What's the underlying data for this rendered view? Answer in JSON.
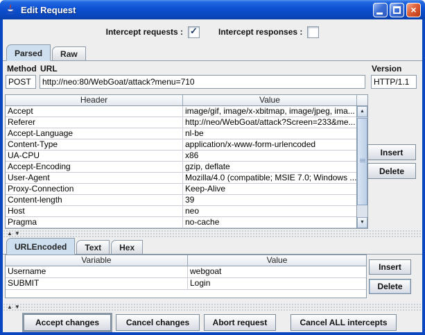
{
  "window": {
    "title": "Edit Request"
  },
  "icons": {
    "close": "×",
    "check": "✓",
    "scroll_up": "▲",
    "scroll_down": "▼",
    "splitter_up": "▲",
    "splitter_down": "▼"
  },
  "intercept": {
    "requests_label": "Intercept requests :",
    "requests_checked": true,
    "responses_label": "Intercept responses :",
    "responses_checked": false
  },
  "request_tabs": {
    "parsed": {
      "label": "Parsed",
      "selected": true
    },
    "raw": {
      "label": "Raw",
      "selected": false
    }
  },
  "request_line": {
    "method_label": "Method",
    "method_value": "POST",
    "url_label": "URL",
    "url_value": "http://neo:80/WebGoat/attack?menu=710",
    "version_label": "Version",
    "version_value": "HTTP/1.1"
  },
  "headers_table": {
    "columns": [
      "Header",
      "Value"
    ],
    "rows": [
      [
        "Accept",
        "image/gif, image/x-xbitmap, image/jpeg, ima..."
      ],
      [
        "Referer",
        "http://neo/WebGoat/attack?Screen=233&me..."
      ],
      [
        "Accept-Language",
        "nl-be"
      ],
      [
        "Content-Type",
        "application/x-www-form-urlencoded"
      ],
      [
        "UA-CPU",
        "x86"
      ],
      [
        "Accept-Encoding",
        "gzip, deflate"
      ],
      [
        "User-Agent",
        "Mozilla/4.0 (compatible; MSIE 7.0; Windows ..."
      ],
      [
        "Proxy-Connection",
        "Keep-Alive"
      ],
      [
        "Content-length",
        "39"
      ],
      [
        "Host",
        "neo"
      ],
      [
        "Pragma",
        "no-cache"
      ]
    ],
    "insert_label": "Insert",
    "delete_label": "Delete"
  },
  "body_tabs": {
    "urlencoded": {
      "label": "URLEncoded",
      "selected": true
    },
    "text": {
      "label": "Text",
      "selected": false
    },
    "hex": {
      "label": "Hex",
      "selected": false
    }
  },
  "params_table": {
    "columns": [
      "Variable",
      "Value"
    ],
    "rows": [
      [
        "Username",
        "webgoat"
      ],
      [
        "SUBMIT",
        "Login"
      ]
    ],
    "insert_label": "Insert",
    "delete_label": "Delete"
  },
  "actions": {
    "accept": "Accept changes",
    "cancel": "Cancel changes",
    "abort": "Abort request",
    "cancel_all": "Cancel ALL intercepts"
  },
  "colors": {
    "titlebar_blue": "#0C50D2",
    "window_border": "#0847C0",
    "panel_bg": "#EEEEEE",
    "selected_tab_bg": "#CEDFF0",
    "control_border": "#7A8A99",
    "close_button_red": "#DD5F38",
    "scroll_thumb": "#C3D4EA"
  }
}
